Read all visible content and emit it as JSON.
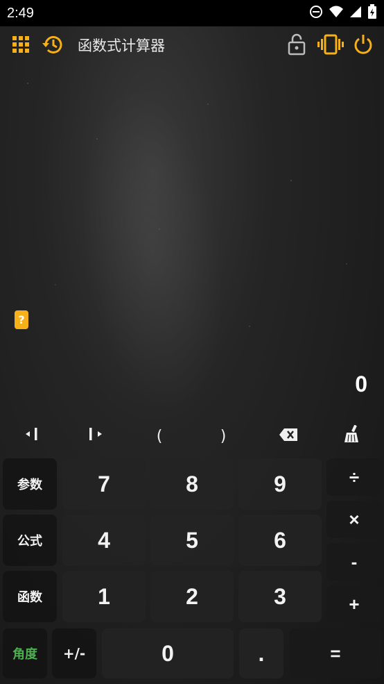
{
  "status_bar": {
    "time": "2:49",
    "icons": [
      "do-not-disturb-icon",
      "wifi-icon",
      "signal-icon",
      "battery-charging-icon"
    ]
  },
  "app_bar": {
    "title": "函数式计算器",
    "accent_color": "#f6b11a",
    "left_icons": [
      "grid-menu-icon",
      "history-icon"
    ],
    "right_icons": [
      "lock-open-icon",
      "vibrate-icon",
      "power-icon"
    ]
  },
  "help_badge": "?",
  "display": {
    "result": "0"
  },
  "edit_row": {
    "cursor_left_label": "◂I",
    "cursor_right_label": "I▸",
    "paren_open": "(",
    "paren_close": ")",
    "icons": [
      "cursor-left-icon",
      "cursor-right-icon",
      "backspace-icon",
      "clear-broom-icon"
    ]
  },
  "keypad": {
    "params": "参数",
    "formula": "公式",
    "function": "函数",
    "angle": "角度",
    "sign": "+/-",
    "k7": "7",
    "k8": "8",
    "k9": "9",
    "k4": "4",
    "k5": "5",
    "k6": "6",
    "k1": "1",
    "k2": "2",
    "k3": "3",
    "k0": "0",
    "dot": ".",
    "equals": "=",
    "divide": "÷",
    "multiply": "×",
    "minus": "-",
    "plus": "+",
    "angle_color": "#4caf50"
  }
}
